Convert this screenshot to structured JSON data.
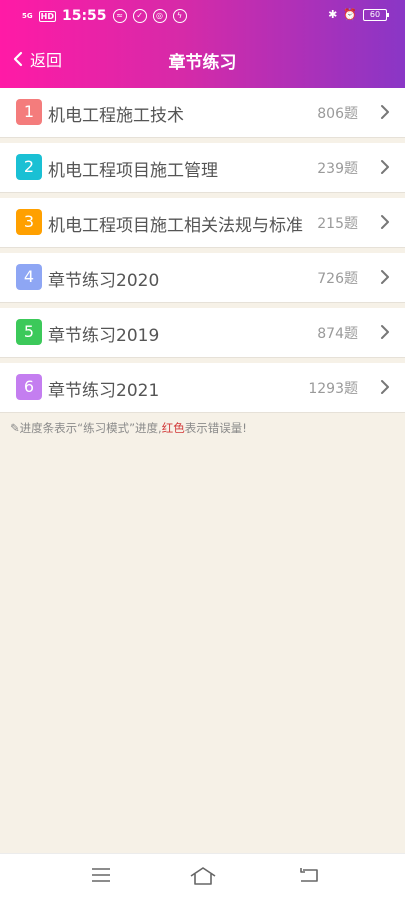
{
  "status_bar": {
    "signal": "5G",
    "hd": "HD",
    "time": "15:55",
    "battery": "60"
  },
  "header": {
    "back_label": "返回",
    "title": "章节练习"
  },
  "chapters": [
    {
      "index": "1",
      "name": "机电工程施工技术",
      "count": "806题",
      "color": "#f47c7c"
    },
    {
      "index": "2",
      "name": "机电工程项目施工管理",
      "count": "239题",
      "color": "#1ac0d4"
    },
    {
      "index": "3",
      "name": "机电工程项目施工相关法规与标准",
      "count": "215题",
      "color": "#ffa000"
    },
    {
      "index": "4",
      "name": "章节练习2020",
      "count": "726题",
      "color": "#8ea6f4"
    },
    {
      "index": "5",
      "name": "章节练习2019",
      "count": "874题",
      "color": "#3cc95a"
    },
    {
      "index": "6",
      "name": "章节练习2021",
      "count": "1293题",
      "color": "#c47ef0"
    }
  ],
  "tip": {
    "part1": "进度条表示“练习模式”进度,",
    "red": "红色",
    "part2": "表示错误量!"
  }
}
